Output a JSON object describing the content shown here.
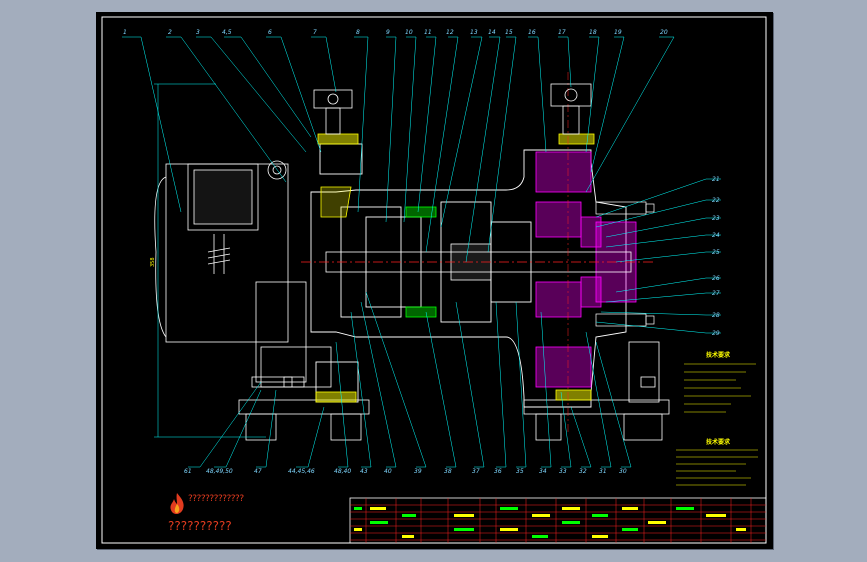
{
  "drawing": {
    "part_numbers_top": [
      "1",
      "2",
      "3",
      "4,5",
      "6",
      "7",
      "8",
      "9",
      "10",
      "11",
      "12",
      "13",
      "14",
      "15",
      "16",
      "17",
      "18",
      "19",
      "20"
    ],
    "part_numbers_right": [
      "21",
      "22",
      "23",
      "24",
      "25",
      "26",
      "27",
      "28",
      "29"
    ],
    "part_numbers_bottom": [
      "61",
      "48,49,50",
      "47",
      "44,45,46",
      "48,40",
      "43",
      "40",
      "39",
      "38",
      "37",
      "36",
      "35",
      "34",
      "33",
      "32",
      "31",
      "30"
    ],
    "dimension_label": "358",
    "notes_heading_1": "技术要求",
    "notes_heading_2": "技术要求",
    "colors": {
      "outline": "#ffffff",
      "leader": "#00ffff",
      "hatch_magenta": "#ff00ff",
      "centerline": "#ff2020",
      "hatch_yellow": "#ffff00",
      "hatch_green": "#00ff00"
    }
  },
  "watermark": {
    "line1": "?????????????",
    "line2": "??????????",
    "icon": "flame-logo-icon"
  }
}
